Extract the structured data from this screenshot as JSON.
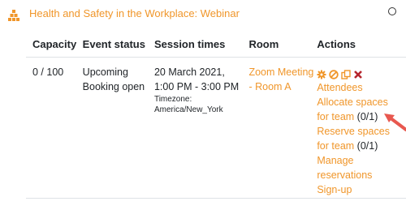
{
  "header": {
    "title": "Health and Safety in the Workplace: Webinar"
  },
  "table": {
    "columns": [
      "Capacity",
      "Event status",
      "Session times",
      "Room",
      "Actions"
    ],
    "row": {
      "capacity": "0 / 100",
      "status_line1": "Upcoming",
      "status_line2": "Booking open",
      "session_date": "20 March 2021,",
      "session_time": "1:00 PM - 3:00 PM",
      "timezone_label": "Timezone:",
      "timezone_value": "America/New_York",
      "room": "Zoom Meeting - Room A",
      "actions": {
        "icons": [
          "settings-icon",
          "cancel-icon",
          "copy-icon",
          "delete-icon"
        ],
        "attendees": "Attendees",
        "allocate_line1": "Allocate spaces",
        "allocate_line2": "for team",
        "allocate_count": "(0/1)",
        "reserve_line1": "Reserve spaces",
        "reserve_line2": "for team",
        "reserve_count": "(0/1)",
        "manage_line1": "Manage",
        "manage_line2": "reservations",
        "signup": "Sign-up"
      }
    }
  },
  "colors": {
    "accent": "#f0962a",
    "delete": "#b5252c",
    "arrow": "#e8584f",
    "border": "#dee2e6"
  }
}
